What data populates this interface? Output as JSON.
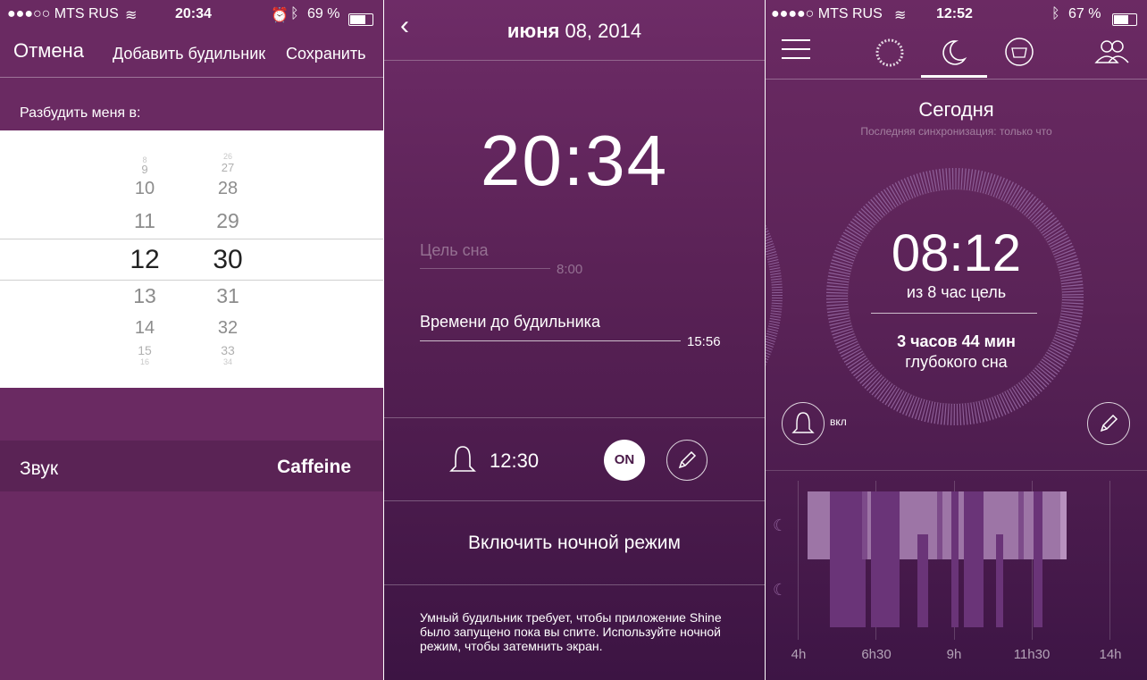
{
  "screen1": {
    "status": {
      "carrier": "●●●○○ MTS RUS",
      "time": "20:34",
      "battery": "69 %",
      "battery_level": 0.69
    },
    "nav": {
      "cancel": "Отмена",
      "title": "Добавить будильник",
      "save": "Сохранить"
    },
    "wake_label": "Разбудить меня в:",
    "picker": {
      "hours": [
        "8",
        "9",
        "10",
        "11",
        "12",
        "13",
        "14",
        "15",
        "16"
      ],
      "minutes": [
        "26",
        "27",
        "28",
        "29",
        "30",
        "31",
        "32",
        "33",
        "34"
      ],
      "selected_hour": "12",
      "selected_minute": "30"
    },
    "sound": {
      "label": "Звук",
      "value": "Caffeine"
    }
  },
  "screen2": {
    "date_month": "июня",
    "date_rest": "08, 2014",
    "clock": "20:34",
    "sleep_goal": {
      "label": "Цель сна",
      "value": "8:00"
    },
    "time_to_alarm": {
      "label": "Времени до будильника",
      "value": "15:56"
    },
    "alarm": {
      "time": "12:30",
      "toggle": "ON"
    },
    "night_mode_button": "Включить ночной режим",
    "note": "Умный будильник требует, чтобы приложение Shine было запущено пока вы спите. Используйте ночной режим, чтобы затемнить экран."
  },
  "screen3": {
    "status": {
      "carrier": "●●●●○ MTS RUS",
      "time": "12:52",
      "battery": "67 %",
      "battery_level": 0.67
    },
    "title": "Сегодня",
    "sync": "Последняя синхронизация: только что",
    "sleep_time": "08:12",
    "goal_prefix": "из",
    "goal_value": "8",
    "goal_suffix": "час цель",
    "deep_sleep_bold": "3 часов 44 мин",
    "deep_sleep_label": "глубокого сна",
    "alarm_label": "вкл",
    "x_axis": [
      "4h",
      "6h30",
      "9h",
      "11h30",
      "14h"
    ],
    "colors": {
      "light_sleep": "#9d75a6",
      "deep_sleep": "#6a3478",
      "accent": "#ffffff"
    }
  }
}
